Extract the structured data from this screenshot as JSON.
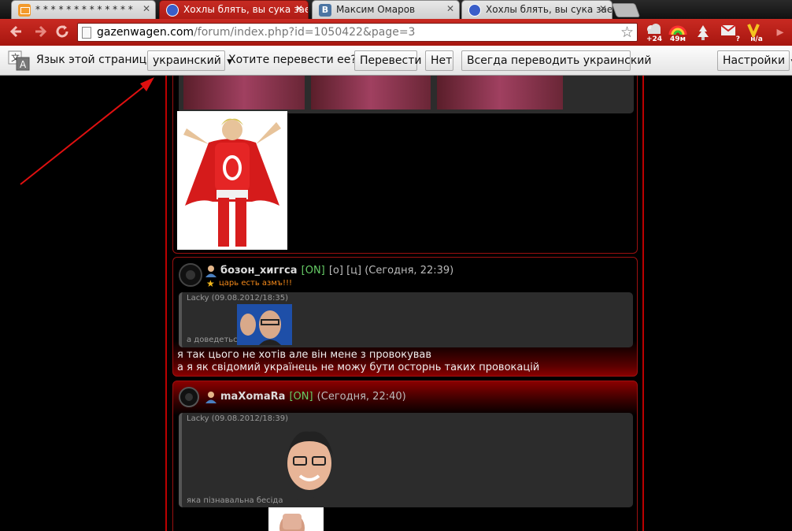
{
  "tabs": [
    {
      "title": "* * * * * * * * * * * * *",
      "active": false,
      "icon": "mail-icon"
    },
    {
      "title": "Хохлы блять, вы сука заеба",
      "active": true,
      "icon": "vw-icon"
    },
    {
      "title": "Максим Омаров",
      "active": false,
      "icon": "vk-icon"
    },
    {
      "title": "Хохлы блять, вы сука заеба",
      "active": false,
      "icon": "vw-icon"
    }
  ],
  "toolbar": {
    "url_host": "gazenwagen.com",
    "url_path": "/forum/index.php?id=1050422&page=3",
    "weather_temp": "+24",
    "counter_49": "49м",
    "gmail_badge": "?",
    "v_badge": "н/а"
  },
  "translate_bar": {
    "language_label": "Язык этой страницы",
    "language_value": "украинский",
    "question": "Хотите перевести ее?",
    "translate_btn": "Перевести",
    "no_btn": "Нет",
    "always_btn": "Всегда переводить украинский",
    "settings_btn": "Настройки"
  },
  "posts": [
    {
      "username": "бозон_хиггса",
      "online": "[ON]",
      "extra": "[о] [ц] (Сегодня, 22:39)",
      "status": "царь есть азмъ!!!",
      "quote_author": "Lacky (09.08.2012/18:35)",
      "quote_text": "а доведеться",
      "body": [
        "я так цього не хотів але він мене з провокував",
        "а я як свідомий українець не можу бути осторнь таких провокацій"
      ]
    },
    {
      "username": "maXomaRa",
      "online": "[ON]",
      "extra": "(Сегодня, 22:40)",
      "quote_author": "Lacky (09.08.2012/18:39)",
      "quote_text": "яка пізнавальна бесіда"
    }
  ],
  "colors": {
    "chrome_red": "#c62b23",
    "post_border": "#9c1010",
    "online_green": "#66cc66",
    "status_orange": "#f68a1a",
    "arrow_red": "#e01010"
  }
}
